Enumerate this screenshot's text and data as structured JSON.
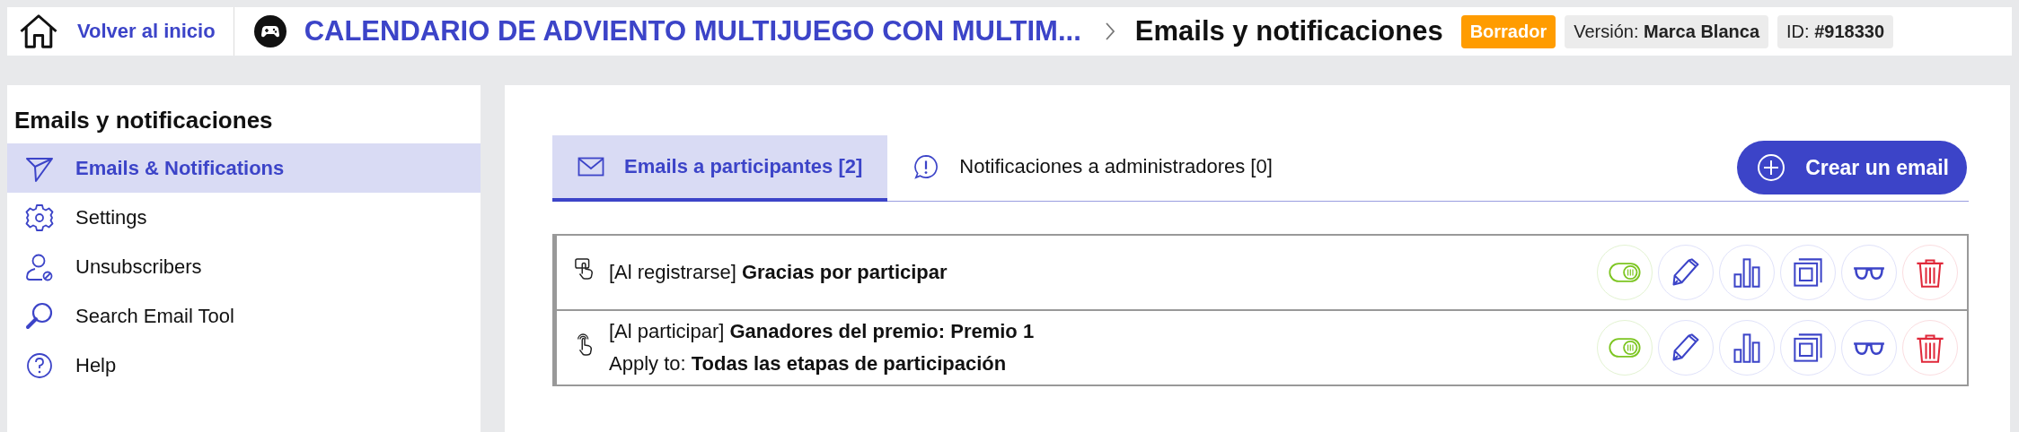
{
  "header": {
    "home_link": "Volver al inicio",
    "project_title": "CALENDARIO DE ADVIENTO MULTIJUEGO CON MULTIM...",
    "page_title": "Emails y notificaciones",
    "status_badge": "Borrador",
    "version": "Versión: **Marca Blanca**",
    "id": "ID: **#918330**"
  },
  "sidebar": {
    "title": "Emails y notificaciones",
    "items": [
      {
        "label": "Emails & Notifications",
        "kind": "send",
        "selected": true
      },
      {
        "label": "Settings",
        "kind": "gear",
        "selected": false
      },
      {
        "label": "Unsubscribers",
        "kind": "user-blocked",
        "selected": false
      },
      {
        "label": "Search Email Tool",
        "kind": "search",
        "selected": false
      },
      {
        "label": "Help",
        "kind": "help",
        "selected": false
      }
    ]
  },
  "tabs": [
    {
      "label": "Emails a participantes [2]",
      "kind": "mail",
      "selected": true
    },
    {
      "label": "Notificaciones a administradores [0]",
      "kind": "alert",
      "selected": false
    }
  ],
  "create_button": "Crear un email",
  "emails": [
    {
      "kind": "touch",
      "line": "[Al registrarse] **Gracias por participar**",
      "active": true
    },
    {
      "kind": "tap",
      "line": "[Al participar] **Ganadores del premio: Premio 1**",
      "apply": "Apply to: **Todas las etapas de participación**",
      "active": true
    }
  ]
}
